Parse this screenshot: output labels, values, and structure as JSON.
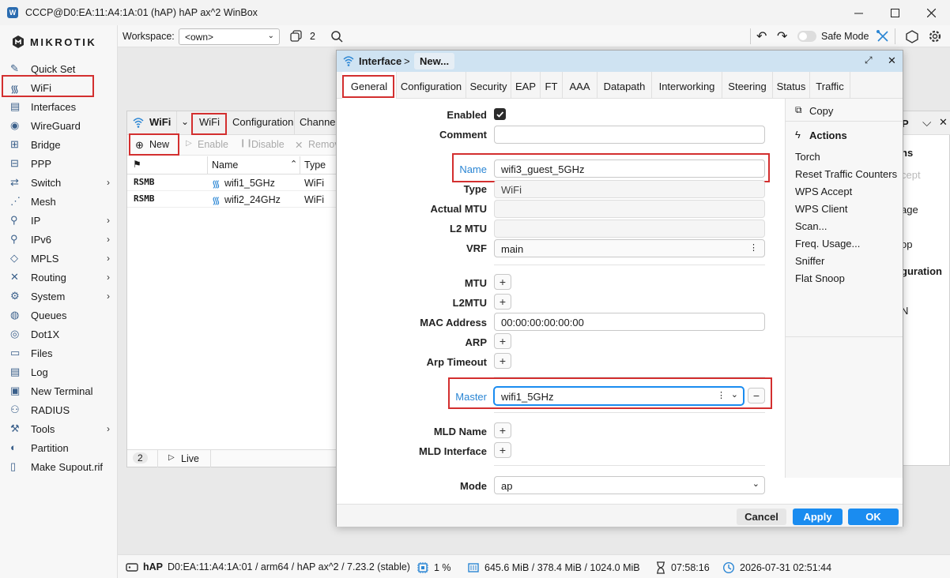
{
  "window": {
    "title": "CCCP@D0:EA:11:A4:1A:01 (hAP) hAP ax^2 WinBox"
  },
  "sidebar": {
    "logo_text": "MIKROTIK",
    "items": [
      {
        "label": "Quick Set",
        "icon": "quick-set-icon"
      },
      {
        "label": "WiFi",
        "icon": "wifi-icon"
      },
      {
        "label": "Interfaces",
        "icon": "interfaces-icon"
      },
      {
        "label": "WireGuard",
        "icon": "wireguard-icon"
      },
      {
        "label": "Bridge",
        "icon": "bridge-icon"
      },
      {
        "label": "PPP",
        "icon": "ppp-icon"
      },
      {
        "label": "Switch",
        "icon": "switch-icon",
        "submenu": true
      },
      {
        "label": "Mesh",
        "icon": "mesh-icon"
      },
      {
        "label": "IP",
        "icon": "ip-icon",
        "submenu": true
      },
      {
        "label": "IPv6",
        "icon": "ipv6-icon",
        "submenu": true
      },
      {
        "label": "MPLS",
        "icon": "mpls-icon",
        "submenu": true
      },
      {
        "label": "Routing",
        "icon": "routing-icon",
        "submenu": true
      },
      {
        "label": "System",
        "icon": "system-icon",
        "submenu": true
      },
      {
        "label": "Queues",
        "icon": "queues-icon"
      },
      {
        "label": "Dot1X",
        "icon": "dot1x-icon"
      },
      {
        "label": "Files",
        "icon": "files-icon"
      },
      {
        "label": "Log",
        "icon": "log-icon"
      },
      {
        "label": "New Terminal",
        "icon": "terminal-icon"
      },
      {
        "label": "RADIUS",
        "icon": "radius-icon"
      },
      {
        "label": "Tools",
        "icon": "tools-icon",
        "submenu": true
      },
      {
        "label": "Partition",
        "icon": "partition-icon"
      },
      {
        "label": "Make Supout.rif",
        "icon": "supout-icon"
      }
    ]
  },
  "toolbar": {
    "workspace_label": "Workspace:",
    "workspace_value": "<own>",
    "windows_count": "2",
    "safe_mode_label": "Safe Mode"
  },
  "wifi_window": {
    "title": "WiFi",
    "tabs": [
      "WiFi",
      "Configuration",
      "Channel"
    ],
    "actions": {
      "new": "New",
      "enable": "Enable",
      "disable": "Disable",
      "remove": "Remov"
    },
    "columns": [
      "Name",
      "Type"
    ],
    "rows": [
      {
        "flag": "RSMB",
        "name": "wifi1_5GHz",
        "type": "WiFi"
      },
      {
        "flag": "RSMB",
        "name": "wifi2_24GHz",
        "type": "WiFi"
      }
    ],
    "footer": {
      "count": "2",
      "live": "Live"
    }
  },
  "behind_window_fragments": {
    "p": "P",
    "ns": "ns",
    "cept": "cept",
    "age": "age",
    "op": "op",
    "guration": "guration",
    "n": "N"
  },
  "dialog": {
    "breadcrumb": "Interface",
    "separator": ">",
    "title": "New...",
    "tabs": [
      "General",
      "Configuration",
      "Security",
      "EAP",
      "FT",
      "AAA",
      "Datapath",
      "Interworking",
      "Steering",
      "Status",
      "Traffic"
    ],
    "fields": {
      "enabled_label": "Enabled",
      "enabled_checked": true,
      "comment_label": "Comment",
      "comment_value": "",
      "name_label": "Name",
      "name_value": "wifi3_guest_5GHz",
      "type_label": "Type",
      "type_value": "WiFi",
      "actual_mtu_label": "Actual MTU",
      "l2_mtu_label": "L2 MTU",
      "vrf_label": "VRF",
      "vrf_value": "main",
      "mtu_label": "MTU",
      "l2mtu_label": "L2MTU",
      "mac_label": "MAC Address",
      "mac_value": "00:00:00:00:00:00",
      "arp_label": "ARP",
      "arp_timeout_label": "Arp Timeout",
      "master_label": "Master",
      "master_value": "wifi1_5GHz",
      "mld_name_label": "MLD Name",
      "mld_interface_label": "MLD Interface",
      "mode_label": "Mode",
      "mode_value": "ap"
    },
    "side": {
      "copy": "Copy",
      "actions_header": "Actions",
      "actions": [
        "Torch",
        "Reset Traffic Counters",
        "WPS Accept",
        "WPS Client",
        "Scan...",
        "Freq. Usage...",
        "Sniffer",
        "Flat Snoop"
      ]
    },
    "buttons": {
      "cancel": "Cancel",
      "apply": "Apply",
      "ok": "OK"
    },
    "colors": {
      "accent": "#1a8cf0",
      "title_bg": "#cfe3f2",
      "highlight": "#d32f2f"
    }
  },
  "statusbar": {
    "device": "hAP",
    "info": "D0:EA:11:A4:1A:01 / arm64 / hAP ax^2 / 7.23.2 (stable)",
    "cpu": "1 %",
    "memory": "645.6 MiB / 378.4 MiB / 1024.0 MiB",
    "uptime": "07:58:16",
    "datetime": "2026-07-31 02:51:44"
  }
}
